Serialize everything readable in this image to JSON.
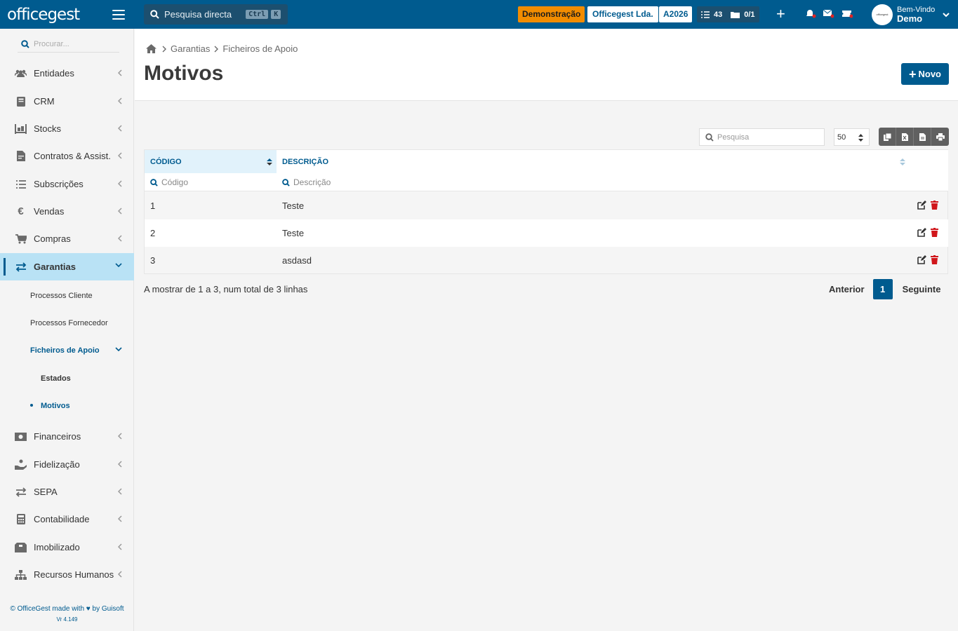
{
  "topbar": {
    "logo": "officegest",
    "search_label": "Pesquisa directa",
    "kbd1": "Ctrl",
    "kbd2": "K",
    "demo_badge": "Demonstração",
    "company_badge": "Officegest Lda.",
    "year_badge": "A2026",
    "tasks_count": "43",
    "docs_count": "0/1",
    "user_greeting": "Bem-Vindo",
    "user_name": "Demo",
    "colors": {
      "bar": "#005b8f",
      "accent": "#f28c00"
    }
  },
  "sidebar": {
    "search_placeholder": "Procurar...",
    "items": [
      {
        "label": "Entidades",
        "icon": "users-icon"
      },
      {
        "label": "CRM",
        "icon": "book-icon"
      },
      {
        "label": "Stocks",
        "icon": "pallet-icon"
      },
      {
        "label": "Contratos & Assist.",
        "icon": "contract-icon"
      },
      {
        "label": "Subscrições",
        "icon": "list-icon"
      },
      {
        "label": "Vendas",
        "icon": "euro-icon"
      },
      {
        "label": "Compras",
        "icon": "cart-icon"
      },
      {
        "label": "Garantias",
        "icon": "exchange-icon"
      },
      {
        "label": "Financeiros",
        "icon": "money-icon"
      },
      {
        "label": "Fidelização",
        "icon": "hand-coin-icon"
      },
      {
        "label": "SEPA",
        "icon": "exchange-icon"
      },
      {
        "label": "Contabilidade",
        "icon": "calculator-icon"
      },
      {
        "label": "Imobilizado",
        "icon": "box-icon"
      },
      {
        "label": "Recursos Humanos",
        "icon": "sitemap-icon"
      }
    ],
    "sub": {
      "processos_cliente": "Processos Cliente",
      "processos_fornecedor": "Processos Fornecedor",
      "ficheiros_apoio": "Ficheiros de Apoio",
      "estados": "Estados",
      "motivos": "Motivos"
    },
    "footer": "© OfficeGest made with ♥ by Guisoft",
    "version": "Vr 4.149"
  },
  "page": {
    "breadcrumb": [
      "Garantias",
      "Ficheiros de Apoio"
    ],
    "title": "Motivos",
    "new_button": "Novo"
  },
  "table": {
    "search_placeholder": "Pesquisa",
    "page_size": "50",
    "headers": {
      "codigo": "CÓDIGO",
      "descricao": "DESCRIÇÃO"
    },
    "filters": {
      "codigo": "Código",
      "descricao": "Descrição"
    },
    "rows": [
      {
        "codigo": "1",
        "descricao": "Teste"
      },
      {
        "codigo": "2",
        "descricao": "Teste"
      },
      {
        "codigo": "3",
        "descricao": "asdasd"
      }
    ],
    "info": "A mostrar de 1 a 3, num total de 3 linhas",
    "pagination": {
      "prev": "Anterior",
      "current": "1",
      "next": "Seguinte"
    }
  }
}
